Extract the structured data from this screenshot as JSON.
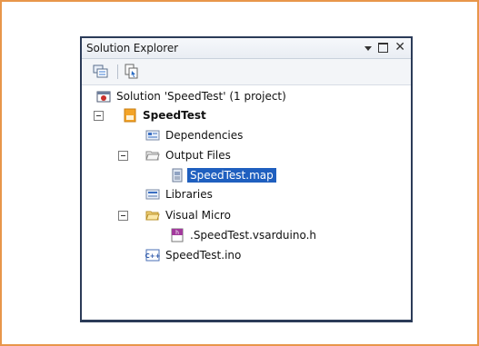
{
  "panel": {
    "title": "Solution Explorer"
  },
  "tree": {
    "solution": "Solution 'SpeedTest' (1 project)",
    "project": "SpeedTest",
    "items": {
      "dependencies": "Dependencies",
      "output_files": "Output Files",
      "speedtest_map": "SpeedTest.map",
      "libraries": "Libraries",
      "visual_micro": "Visual Micro",
      "vsarduino_h": ".SpeedTest.vsarduino.h",
      "speedtest_ino": "SpeedTest.ino"
    }
  },
  "colors": {
    "frame_border": "#e8964a",
    "window_border": "#2b3b58",
    "selection": "#1f5fbf"
  },
  "icons": {
    "toolbar": [
      "properties-icon",
      "show-all-files-icon"
    ],
    "title": [
      "dropdown-arrow-icon",
      "maximize-icon",
      "close-icon"
    ]
  }
}
